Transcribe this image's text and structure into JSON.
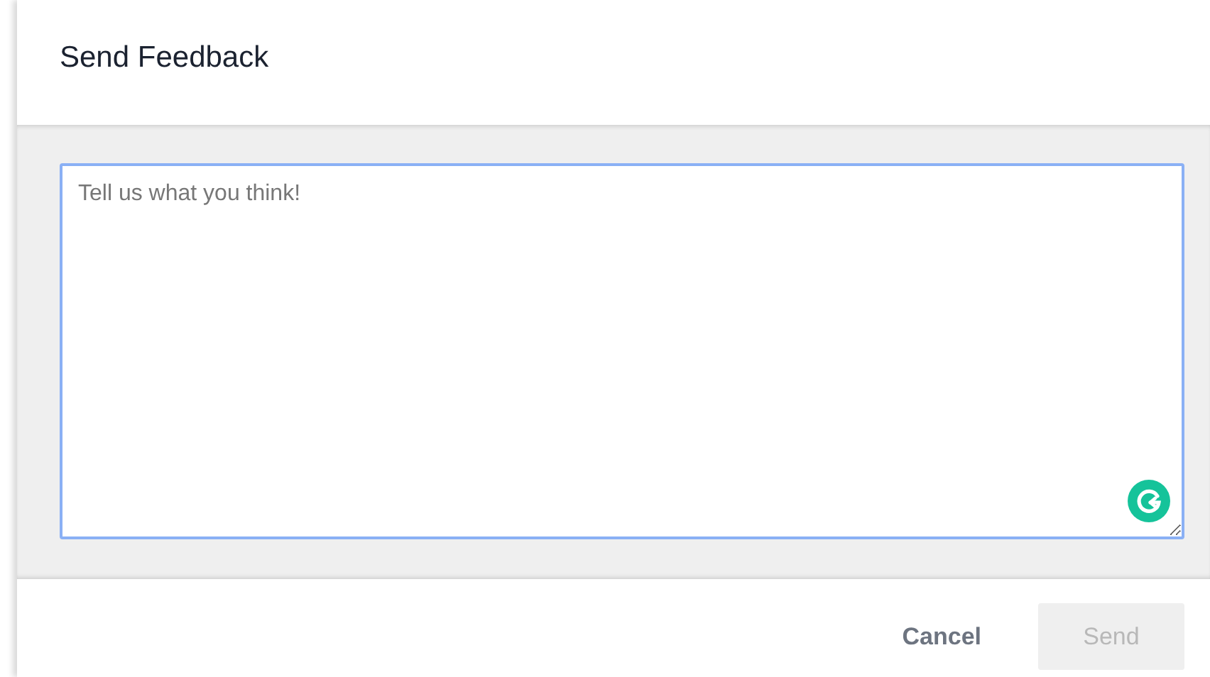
{
  "dialog": {
    "title": "Send Feedback"
  },
  "feedback": {
    "placeholder": "Tell us what you think!",
    "focused": true
  },
  "buttons": [
    {
      "label": "Cancel",
      "kind": "text",
      "disabled": false
    },
    {
      "label": "Send",
      "kind": "filled",
      "disabled": true
    }
  ]
}
